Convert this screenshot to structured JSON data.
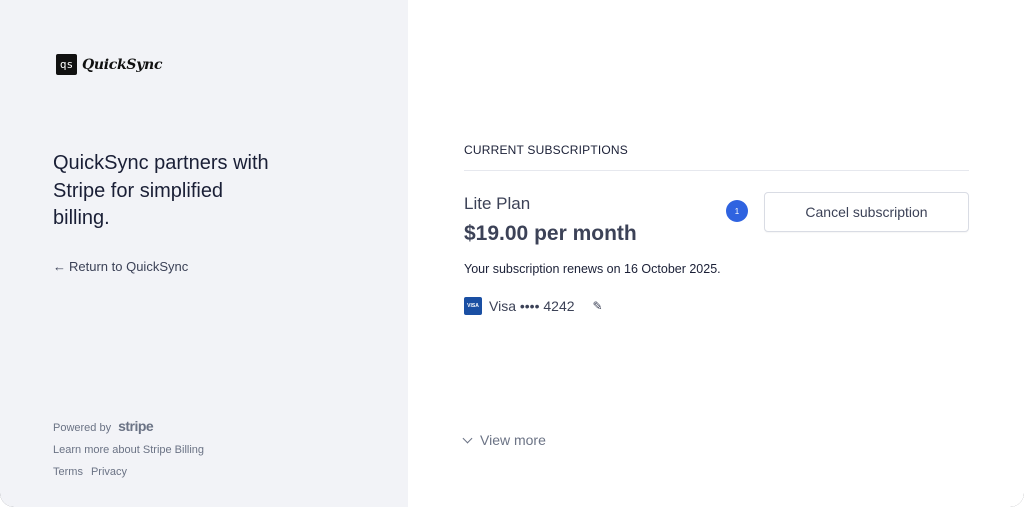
{
  "brand": {
    "logo_mark": "qs",
    "logo_word": "QuickSync"
  },
  "left_panel": {
    "headline": "QuickSync partners with Stripe for simplified billing.",
    "return_label": "Return to QuickSync",
    "powered_by_label": "Powered by",
    "stripe_word": "stripe",
    "learn_more": "Learn more about Stripe Billing",
    "terms": "Terms",
    "privacy": "Privacy"
  },
  "subscription": {
    "section_title": "CURRENT SUBSCRIPTIONS",
    "plan_name": "Lite Plan",
    "price": "$19.00 per month",
    "renewal_text": "Your subscription renews on 16 October 2025.",
    "card_brand_badge": "VISA",
    "card_text": "Visa •••• 4242",
    "badge_count": "1",
    "cancel_label": "Cancel subscription",
    "view_more": "View more"
  },
  "colors": {
    "left_bg": "#f2f3f7",
    "accent_badge": "#2f63e0",
    "visa_blue": "#1a4fa3"
  },
  "icons": {
    "back": "arrow-left-icon",
    "edit": "pencil-icon",
    "expand": "chevron-down-icon"
  }
}
